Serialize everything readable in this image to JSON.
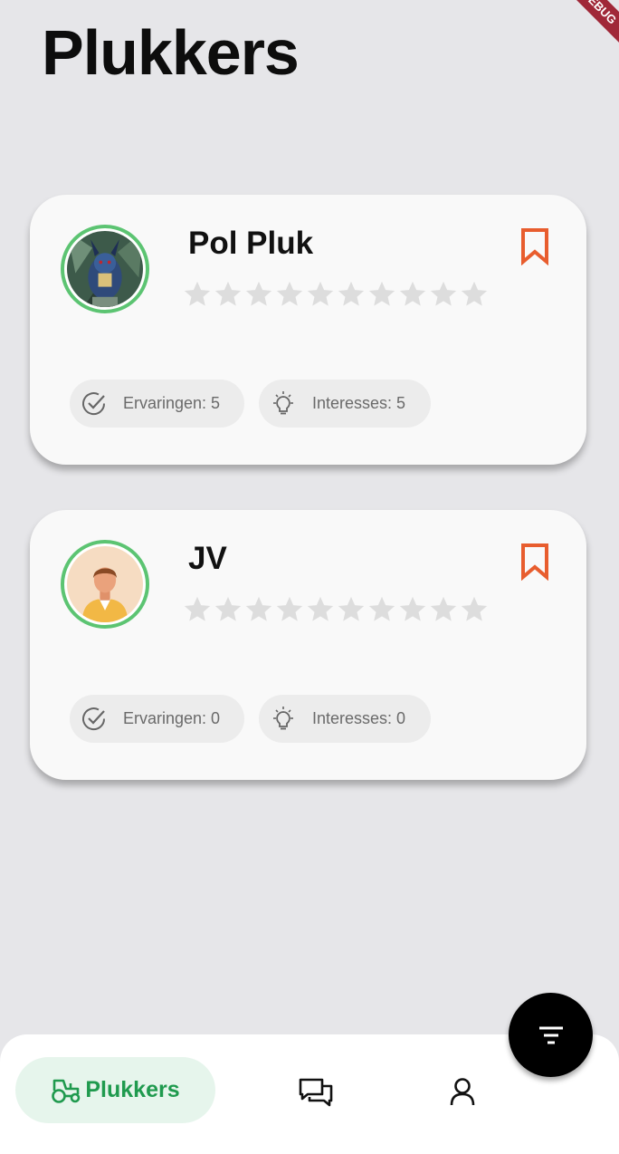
{
  "page": {
    "title": "Plukkers"
  },
  "debug_banner": "DEBUG",
  "cards": [
    {
      "name": "Pol Pluk",
      "rating": 0,
      "max_rating": 10,
      "experiences_label": "Ervaringen: 5",
      "interests_label": "Interesses: 5",
      "avatar": "pokemon-avatar",
      "bookmark_icon": "bookmark-icon"
    },
    {
      "name": "JV",
      "rating": 0,
      "max_rating": 10,
      "experiences_label": "Ervaringen: 0",
      "interests_label": "Interesses: 0",
      "avatar": "person-avatar",
      "bookmark_icon": "bookmark-icon"
    }
  ],
  "nav": {
    "items": [
      {
        "label": "Plukkers",
        "icon": "tractor-icon",
        "active": true
      },
      {
        "label": "",
        "icon": "chat-icon",
        "active": false
      },
      {
        "label": "",
        "icon": "profile-icon",
        "active": false
      }
    ]
  },
  "fab": {
    "icon": "filter-icon"
  },
  "colors": {
    "accent_green": "#1f9a4e",
    "avatar_ring": "#5cc472",
    "bookmark": "#e85d2e",
    "star_empty": "#dddddd",
    "background": "#e6e6e9"
  }
}
